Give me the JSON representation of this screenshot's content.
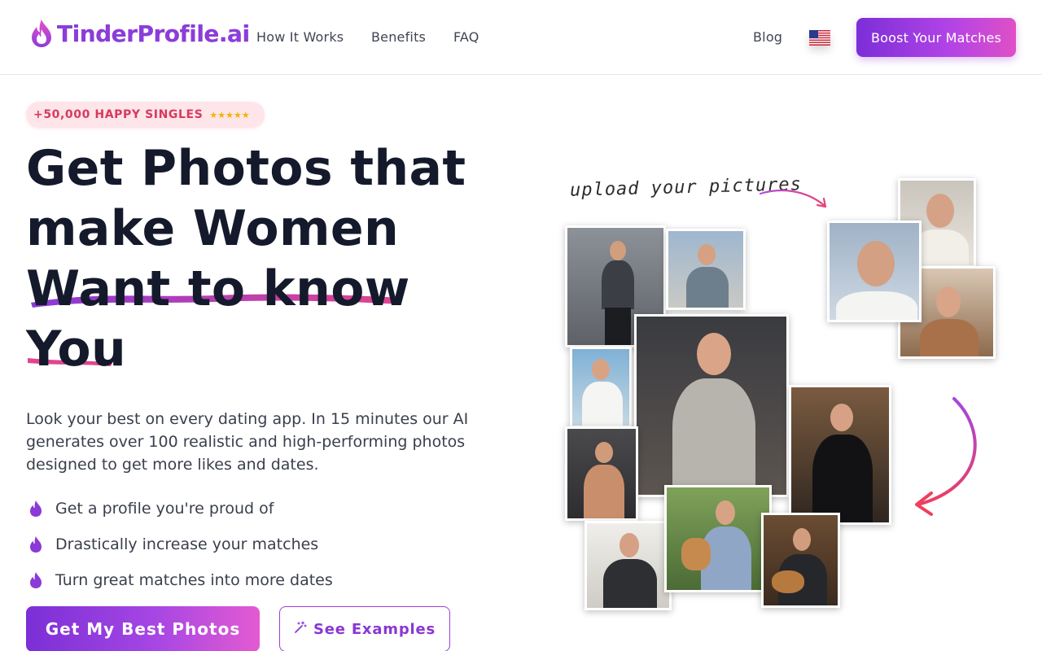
{
  "nav": {
    "logo_text": "TinderProfile.ai",
    "links": [
      "How It Works",
      "Benefits",
      "FAQ"
    ],
    "blog": "Blog",
    "cta": "Boost Your Matches",
    "language": "us-flag-icon"
  },
  "hero": {
    "badge_text": "+50,000 HAPPY SINGLES",
    "badge_stars": "★★★★★",
    "headline": {
      "line1": "Get Photos that",
      "line2": "make Women",
      "line3": "Want to know",
      "line4": "You"
    },
    "lead": "Look your best on every dating app. In 15 minutes our AI generates over 100 realistic and high-performing photos designed to get more likes and dates.",
    "benefits": [
      "Get a profile you're proud of",
      "Drastically increase your matches",
      "Turn great matches into more dates"
    ],
    "primary_cta": "Get My Best Photos",
    "secondary_cta": "See Examples",
    "collage_note": "upload your pictures"
  },
  "colors": {
    "brand_purple": "#8b3dd9",
    "brand_pink": "#e04fc6",
    "badge_bg": "#fde5ea",
    "badge_text": "#d63a5c",
    "headline": "#141a2b"
  }
}
